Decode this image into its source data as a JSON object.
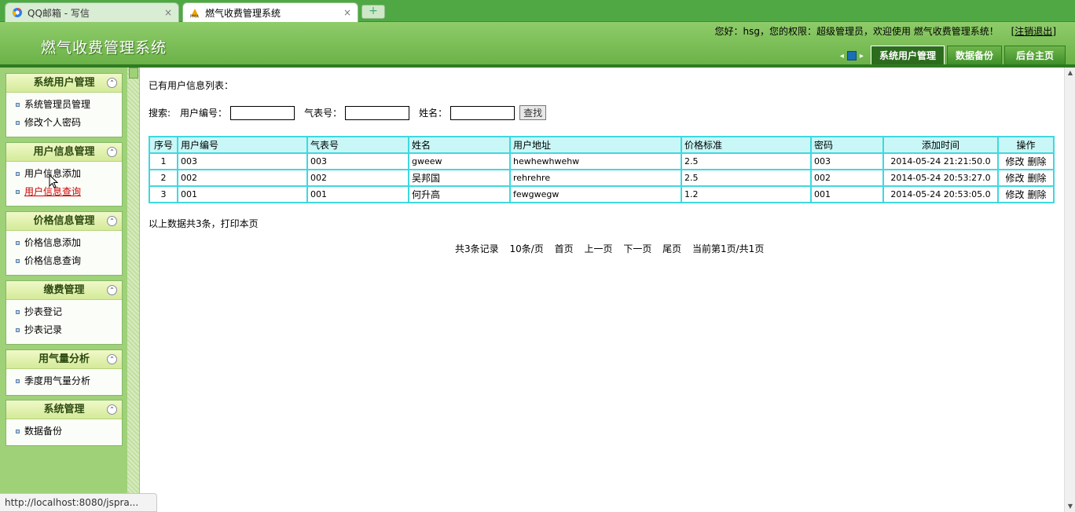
{
  "browser": {
    "tabs": [
      {
        "title": "QQ邮箱 - 写信",
        "close": "×"
      },
      {
        "title": "燃气收费管理系统",
        "close": "×"
      }
    ],
    "new_tab": "+",
    "status_url": "http://localhost:8080/jspra..."
  },
  "header": {
    "title": "燃气收费管理系统",
    "welcome_prefix": "您好：hsg，您的权限：超级管理员，欢迎使用 燃气收费管理系统！",
    "logout_label": "注销退出",
    "bracket_open": "[",
    "bracket_close": "]",
    "nav": [
      {
        "label": "系统用户管理",
        "active": true
      },
      {
        "label": "数据备份",
        "active": false
      },
      {
        "label": "后台主页",
        "active": false
      }
    ],
    "nav_prev": "◂",
    "nav_next": "▸"
  },
  "sidebar": {
    "collapse_symbol": "⌃",
    "panels": [
      {
        "title": "系统用户管理",
        "items": [
          "系统管理员管理",
          "修改个人密码"
        ]
      },
      {
        "title": "用户信息管理",
        "items": [
          "用户信息添加",
          "用户信息查询"
        ]
      },
      {
        "title": "价格信息管理",
        "items": [
          "价格信息添加",
          "价格信息查询"
        ]
      },
      {
        "title": "缴费管理",
        "items": [
          "抄表登记",
          "抄表记录"
        ]
      },
      {
        "title": "用气量分析",
        "items": [
          "季度用气量分析"
        ]
      },
      {
        "title": "系统管理",
        "items": [
          "数据备份"
        ]
      }
    ]
  },
  "main": {
    "list_title": "已有用户信息列表：",
    "search": {
      "label": "搜索:",
      "user_no_label": "用户编号：",
      "meter_no_label": "气表号：",
      "name_label": "姓名：",
      "user_no_value": "",
      "meter_no_value": "",
      "name_value": "",
      "button": "查找"
    },
    "table": {
      "headers": [
        "序号",
        "用户编号",
        "气表号",
        "姓名",
        "用户地址",
        "价格标准",
        "密码",
        "添加时间",
        "操作"
      ],
      "rows": [
        [
          "1",
          "003",
          "003",
          "gweew",
          "hewhewhwehw",
          "2.5",
          "003",
          "2014-05-24 21:21:50.0"
        ],
        [
          "2",
          "002",
          "002",
          "吴邦国",
          "rehrehre",
          "2.5",
          "002",
          "2014-05-24 20:53:27.0"
        ],
        [
          "3",
          "001",
          "001",
          "何升高",
          "fewgwegw",
          "1.2",
          "001",
          "2014-05-24 20:53:05.0"
        ]
      ],
      "edit_label": "修改",
      "delete_label": "删除"
    },
    "summary": "以上数据共3条，打印本页",
    "pager": [
      "共3条记录",
      "10条/页",
      "首页",
      "上一页",
      "下一页",
      "尾页",
      "当前第1页/共1页"
    ]
  },
  "colors": {
    "header_green": "#6bb248",
    "sidebar_green": "#9fd179",
    "table_border": "#3fd8e0",
    "table_head_bg": "#c9f7f7",
    "active_link": "#cc0000"
  }
}
